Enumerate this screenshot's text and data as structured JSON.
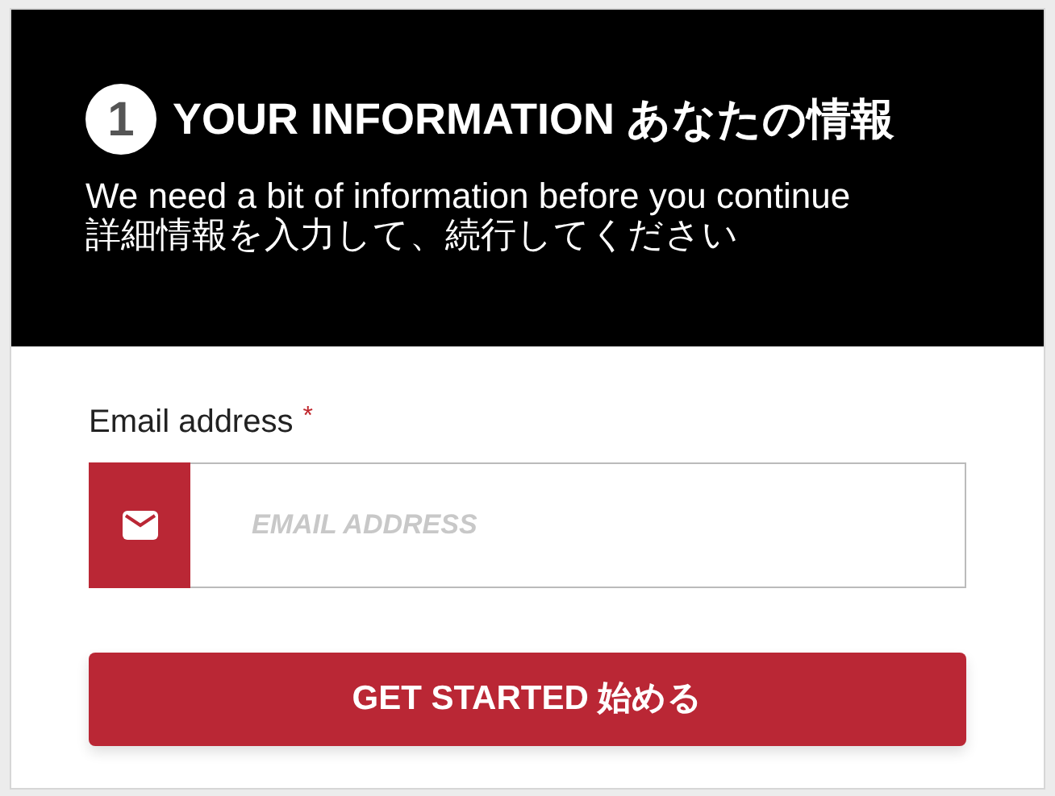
{
  "header": {
    "step": "1",
    "title": "YOUR INFORMATION あなたの情報",
    "description": "We need a bit of information before you continue　詳細情報を入力して、続行してください"
  },
  "email_field": {
    "label": "Email address",
    "required_mark": "*",
    "placeholder": "EMAIL ADDRESS"
  },
  "submit_button": {
    "label": "GET STARTED 始める"
  }
}
